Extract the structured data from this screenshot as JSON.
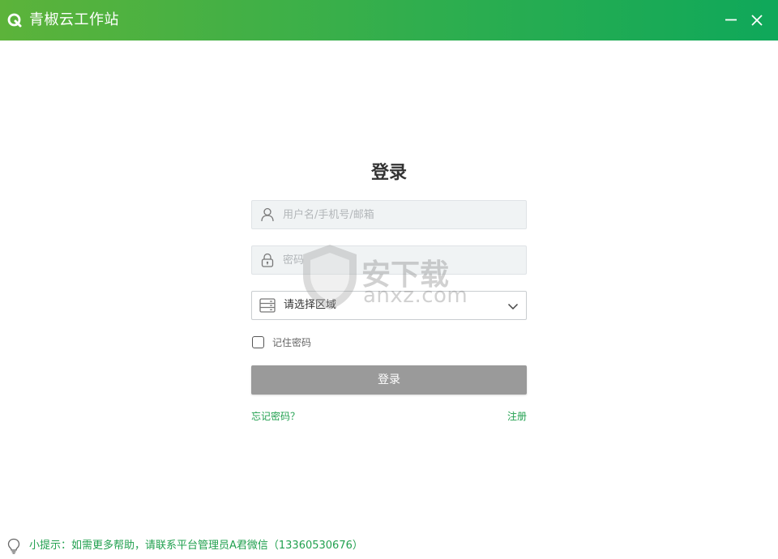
{
  "window": {
    "title": "青椒云工作站",
    "accent": "#21a04f"
  },
  "controls": {
    "minimize_icon": "minimize-icon",
    "close_icon": "close-icon"
  },
  "login": {
    "heading": "登录",
    "username_placeholder": "用户名/手机号/邮箱",
    "password_placeholder": "密码",
    "region_value": "请选择区域",
    "remember_label": "记住密码",
    "remember_checked": false,
    "submit_label": "登录",
    "forgot_label": "忘记密码？",
    "register_label": "注册"
  },
  "tip": {
    "text": "小提示：如需更多帮助，请联系平台管理员A君微信（13360530676）"
  },
  "watermark": {
    "cn": "安下载",
    "en": "anxz.com"
  }
}
